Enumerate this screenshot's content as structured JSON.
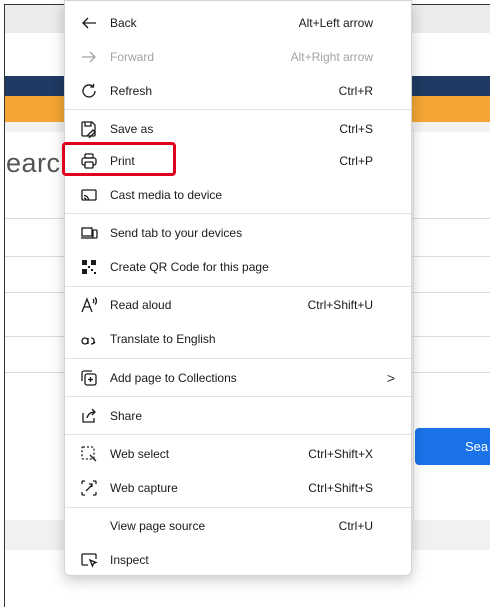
{
  "background": {
    "search_text": "earch",
    "search_button": "Sea"
  },
  "menu": {
    "items": [
      {
        "id": "back",
        "label": "Back",
        "shortcut": "Alt+Left arrow",
        "icon": "arrow-left-icon",
        "disabled": false
      },
      {
        "id": "forward",
        "label": "Forward",
        "shortcut": "Alt+Right arrow",
        "icon": "arrow-right-icon",
        "disabled": true
      },
      {
        "id": "refresh",
        "label": "Refresh",
        "shortcut": "Ctrl+R",
        "icon": "refresh-icon",
        "disabled": false
      },
      {
        "id": "save-as",
        "label": "Save as",
        "shortcut": "Ctrl+S",
        "icon": "save-icon",
        "disabled": false
      },
      {
        "id": "print",
        "label": "Print",
        "shortcut": "Ctrl+P",
        "icon": "printer-icon",
        "disabled": false
      },
      {
        "id": "cast",
        "label": "Cast media to device",
        "shortcut": "",
        "icon": "cast-icon",
        "disabled": false
      },
      {
        "id": "send-tab",
        "label": "Send tab to your devices",
        "shortcut": "",
        "icon": "devices-icon",
        "disabled": false
      },
      {
        "id": "qr-code",
        "label": "Create QR Code for this page",
        "shortcut": "",
        "icon": "qr-code-icon",
        "disabled": false
      },
      {
        "id": "read-aloud",
        "label": "Read aloud",
        "shortcut": "Ctrl+Shift+U",
        "icon": "read-aloud-icon",
        "disabled": false
      },
      {
        "id": "translate",
        "label": "Translate to English",
        "shortcut": "",
        "icon": "translate-icon",
        "disabled": false
      },
      {
        "id": "collections",
        "label": "Add page to Collections",
        "shortcut": "",
        "icon": "collections-icon",
        "disabled": false,
        "submenu": true
      },
      {
        "id": "share",
        "label": "Share",
        "shortcut": "",
        "icon": "share-icon",
        "disabled": false
      },
      {
        "id": "web-select",
        "label": "Web select",
        "shortcut": "Ctrl+Shift+X",
        "icon": "web-select-icon",
        "disabled": false
      },
      {
        "id": "web-capture",
        "label": "Web capture",
        "shortcut": "Ctrl+Shift+S",
        "icon": "web-capture-icon",
        "disabled": false
      },
      {
        "id": "view-source",
        "label": "View page source",
        "shortcut": "Ctrl+U",
        "icon": "",
        "disabled": false
      },
      {
        "id": "inspect",
        "label": "Inspect",
        "shortcut": "",
        "icon": "inspect-icon",
        "disabled": false
      }
    ],
    "submenu_glyph": ">",
    "highlight_color": "#e0001b"
  }
}
